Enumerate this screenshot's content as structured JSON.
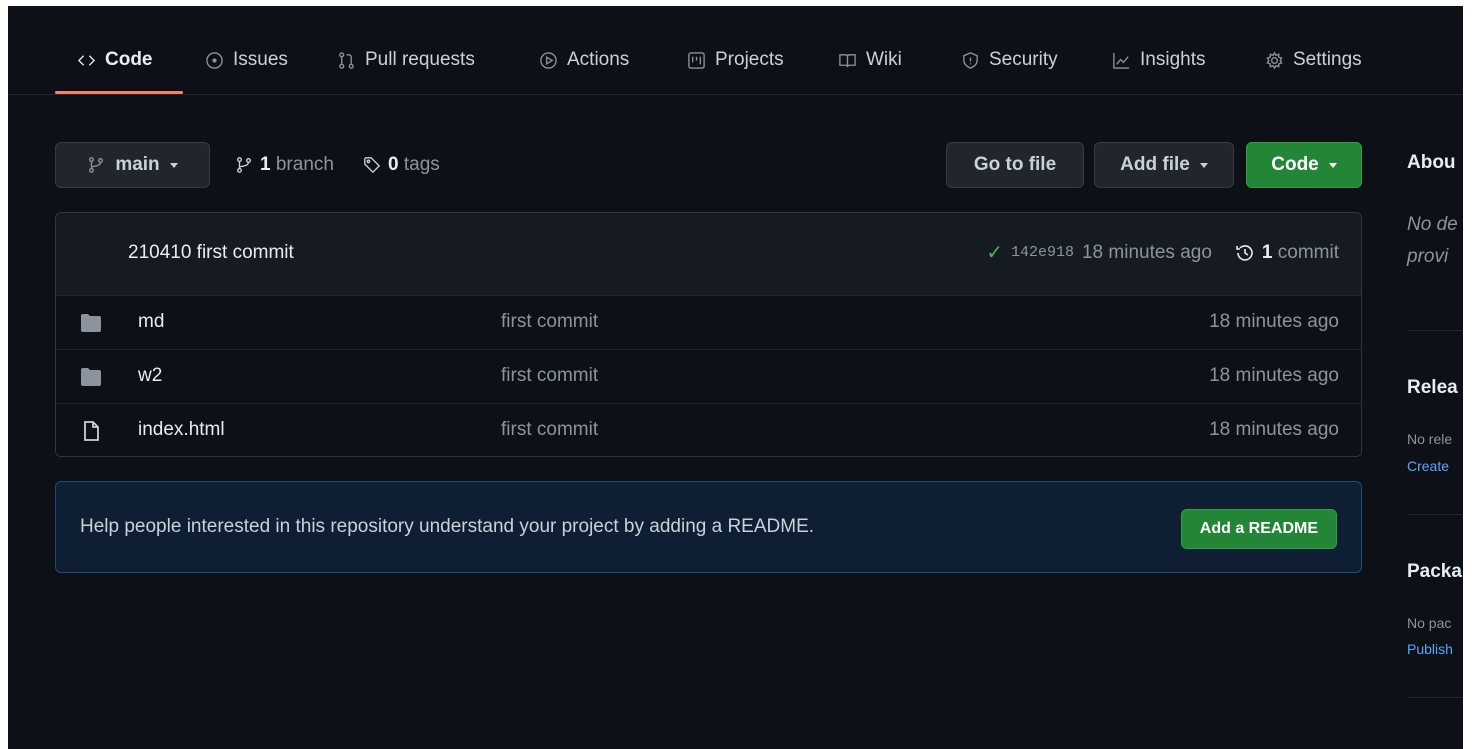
{
  "nav": {
    "tabs": [
      {
        "label": "Code",
        "icon": "code-icon",
        "selected": true
      },
      {
        "label": "Issues",
        "icon": "issue-icon"
      },
      {
        "label": "Pull requests",
        "icon": "pull-request-icon"
      },
      {
        "label": "Actions",
        "icon": "play-icon"
      },
      {
        "label": "Projects",
        "icon": "project-icon"
      },
      {
        "label": "Wiki",
        "icon": "book-icon"
      },
      {
        "label": "Security",
        "icon": "shield-icon"
      },
      {
        "label": "Insights",
        "icon": "graph-icon"
      },
      {
        "label": "Settings",
        "icon": "gear-icon"
      }
    ]
  },
  "toolbar": {
    "branch_button": "main",
    "branch_count": "1",
    "branch_label": "branch",
    "tag_count": "0",
    "tag_label": "tags",
    "go_to_file": "Go to file",
    "add_file": "Add file",
    "code": "Code"
  },
  "latest_commit": {
    "message": "210410 first commit",
    "sha": "142e918",
    "time": "18 minutes ago",
    "commit_count": "1",
    "commit_label": "commit"
  },
  "files": [
    {
      "name": "md",
      "type": "folder",
      "commit": "first commit",
      "age": "18 minutes ago"
    },
    {
      "name": "w2",
      "type": "folder",
      "commit": "first commit",
      "age": "18 minutes ago"
    },
    {
      "name": "index.html",
      "type": "file",
      "commit": "first commit",
      "age": "18 minutes ago"
    }
  ],
  "readme_banner": {
    "text": "Help people interested in this repository understand your project by adding a README.",
    "button": "Add a README"
  },
  "sidebar": {
    "about_title": "Abou",
    "about_line1": "No de",
    "about_line2": "provi",
    "releases_title": "Relea",
    "releases_text": "No rele",
    "releases_link": "Create",
    "packages_title": "Packa",
    "packages_text": "No pac",
    "packages_link": "Publish"
  },
  "colors": {
    "background": "#0d1117",
    "accent_underline": "#f78166",
    "green": "#238636",
    "link": "#58a6ff"
  }
}
